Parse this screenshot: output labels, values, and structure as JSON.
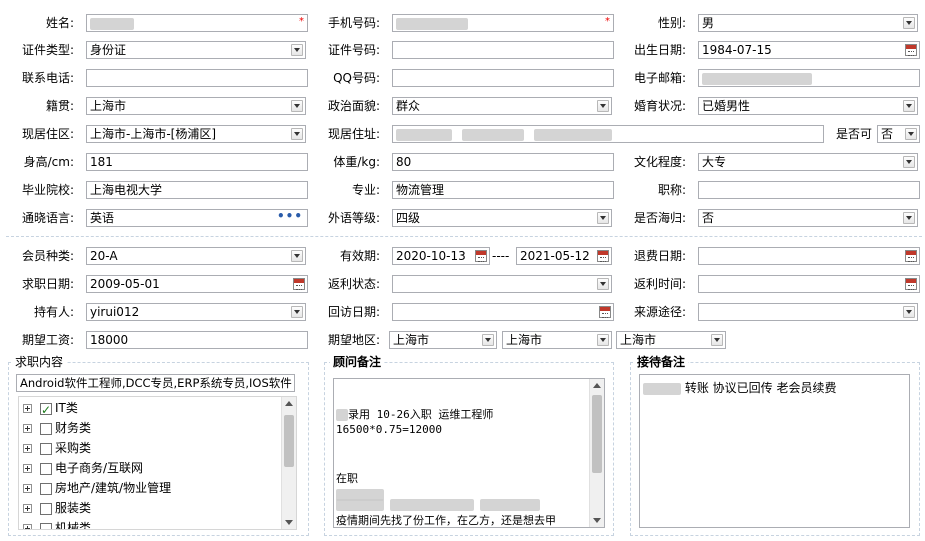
{
  "rows": {
    "r1": {
      "name_label": "姓名:",
      "phone_label": "手机号码:",
      "gender_label": "性别:",
      "gender": "男",
      "required": "*"
    },
    "r2": {
      "idtype_label": "证件类型:",
      "idtype": "身份证",
      "idno_label": "证件号码:",
      "birth_label": "出生日期:",
      "birth": "1984-07-15"
    },
    "r3": {
      "contact_label": "联系电话:",
      "qq_label": "QQ号码:",
      "email_label": "电子邮箱:"
    },
    "r4": {
      "origin_label": "籍贯:",
      "origin": "上海市",
      "political_label": "政治面貌:",
      "political": "群众",
      "marital_label": "婚育状况:",
      "marital": "已婚男性"
    },
    "r5": {
      "district_label": "现居住区:",
      "district": "上海市-上海市-[杨浦区]",
      "address_label": "现居住址:",
      "option_label": "是否可",
      "option": "否"
    },
    "r6": {
      "height_label": "身高/cm:",
      "height": "181",
      "weight_label": "体重/kg:",
      "weight": "80",
      "edu_label": "文化程度:",
      "edu": "大专"
    },
    "r7": {
      "school_label": "毕业院校:",
      "school": "上海电视大学",
      "major_label": "专业:",
      "major": "物流管理",
      "title_label": "职称:"
    },
    "r8": {
      "lang_label": "通晓语言:",
      "lang": "英语",
      "lang_more": "•••",
      "level_label": "外语等级:",
      "level": "四级",
      "abroad_label": "是否海归:",
      "abroad": "否"
    }
  },
  "membership": {
    "type_label": "会员种类:",
    "type": "20-A",
    "valid_label": "有效期:",
    "valid_from": "2020-10-13",
    "valid_sep": "----",
    "valid_to": "2021-05-12",
    "refund_label": "退费日期:",
    "jobdate_label": "求职日期:",
    "jobdate": "2009-05-01",
    "rebate_status_label": "返利状态:",
    "rebate_time_label": "返利时间:",
    "holder_label": "持有人:",
    "holder": "yirui012",
    "revisit_label": "回访日期:",
    "source_label": "来源途径:",
    "salary_label": "期望工资:",
    "salary": "18000",
    "region_label": "期望地区:",
    "region1": "上海市",
    "region2": "上海市",
    "region3": "上海市"
  },
  "job_content": {
    "legend": "求职内容",
    "summary": "Android软件工程师,DCC专员,ERP系统专员,IOS软件",
    "categories": [
      {
        "label": "IT类",
        "checked": true
      },
      {
        "label": "财务类",
        "checked": false
      },
      {
        "label": "采购类",
        "checked": false
      },
      {
        "label": "电子商务/互联网",
        "checked": false
      },
      {
        "label": "房地产/建筑/物业管理",
        "checked": false
      },
      {
        "label": "服装类",
        "checked": false
      },
      {
        "label": "机械类",
        "checked": false
      }
    ]
  },
  "consultant_notes": {
    "legend": "顾问备注",
    "line1": "录用 10-26入职  运维工程师",
    "line2": "16500*0.75=12000",
    "line3": "在职",
    "line4": "疫情期间先找了份工作，在乙方，还是想去甲"
  },
  "reception_notes": {
    "legend": "接待备注",
    "line1": "转账 协议已回传  老会员续费"
  },
  "colors": {
    "border": "#abadb3",
    "separator": "#c7d3e0",
    "required": "#e00"
  },
  "icons": [
    "dropdown-arrow-icon",
    "calendar-icon",
    "ellipsis-icon",
    "expand-plus-icon",
    "checkbox-icon"
  ]
}
